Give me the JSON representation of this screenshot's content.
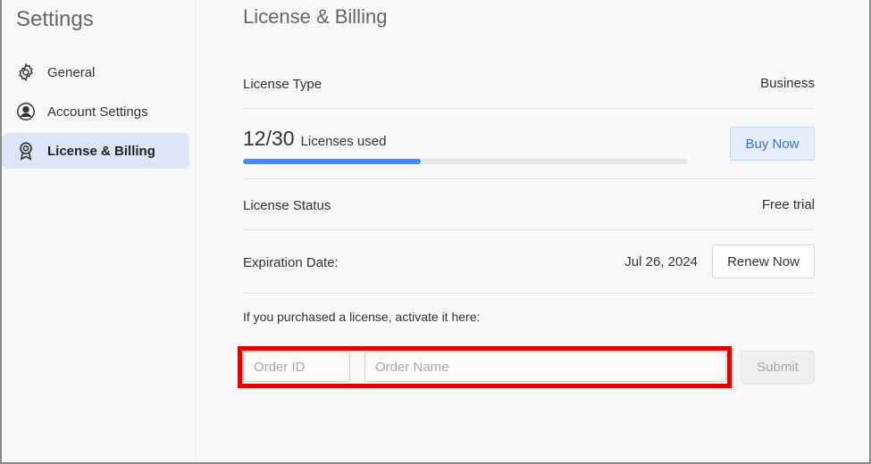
{
  "sidebar": {
    "title": "Settings",
    "items": [
      {
        "label": "General",
        "icon": "gear-icon",
        "active": false
      },
      {
        "label": "Account Settings",
        "icon": "user-circle-icon",
        "active": false
      },
      {
        "label": "License & Billing",
        "icon": "badge-icon",
        "active": true
      }
    ]
  },
  "main": {
    "title": "License & Billing",
    "license_type": {
      "label": "License Type",
      "value": "Business"
    },
    "licenses": {
      "used_text": "12/30",
      "label": "Licenses used",
      "used": 12,
      "total": 30,
      "button": "Buy Now"
    },
    "status": {
      "label": "License Status",
      "value": "Free trial"
    },
    "expiration": {
      "label": "Expiration Date:",
      "value": "Jul 26, 2024",
      "button": "Renew Now"
    },
    "activate": {
      "text": "If you purchased a license, activate it here:",
      "order_id_placeholder": "Order ID",
      "order_name_placeholder": "Order Name",
      "order_id_value": "",
      "order_name_value": "",
      "submit": "Submit"
    }
  },
  "colors": {
    "accent": "#4a8af0",
    "active_nav_bg": "#dce6f7",
    "highlight": "#e00000"
  }
}
